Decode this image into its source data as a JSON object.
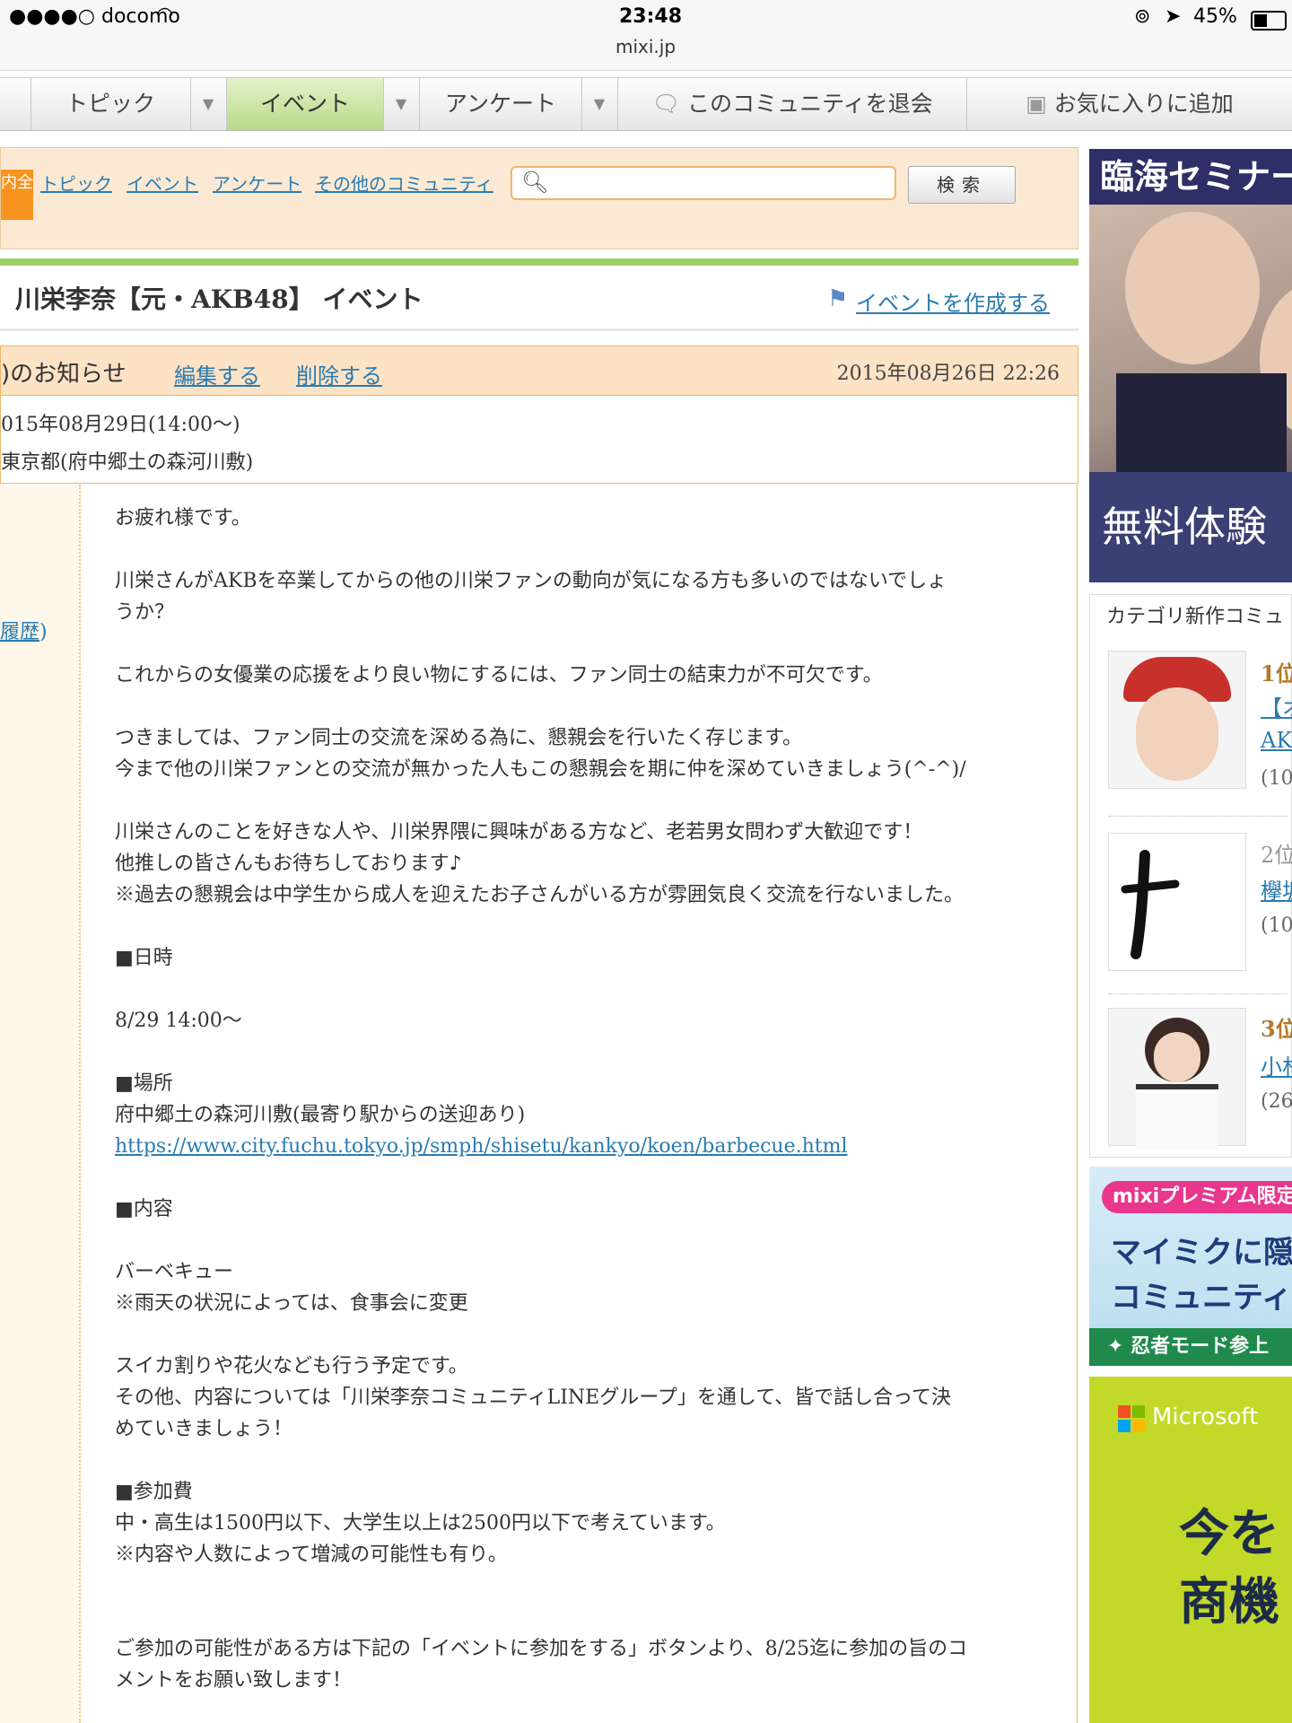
{
  "status_bar": {
    "carrier": "●●●●○ docomo",
    "time": "23:48",
    "url": "mixi.jp",
    "battery": "45%"
  },
  "tabs": [
    {
      "label": "トピック"
    },
    {
      "label": "イベント"
    },
    {
      "label": "アンケート"
    },
    {
      "label": "このコミュニティを退会"
    },
    {
      "label": "お気に入りに追加"
    }
  ],
  "search": {
    "badge": "内全",
    "links": [
      "トピック",
      "イベント",
      "アンケート",
      "その他のコミュニティ"
    ],
    "button": "検索",
    "placeholder": ""
  },
  "page": {
    "title": "川栄李奈【元・AKB48】 イベント",
    "create_link": "イベントを作成する"
  },
  "notice": {
    "label": ")のお知らせ",
    "edit": "編集する",
    "delete": "削除する",
    "date": "2015年08月26日 22:26",
    "event_date": "015年08月29日(14:00〜)",
    "event_place": "東京都(府中郷土の森河川敷)"
  },
  "history_link": "履歴",
  "body_lines": [
    "お疲れ様です。",
    "",
    "川栄さんがAKBを卒業してからの他の川栄ファンの動向が気になる方も多いのではないでしょ",
    "うか？",
    "",
    "これからの女優業の応援をより良い物にするには、ファン同士の結束力が不可欠です。",
    "",
    "つきましては、ファン同士の交流を深める為に、懇親会を行いたく存じます。",
    "今まで他の川栄ファンとの交流が無かった人もこの懇親会を期に仲を深めていきましょう(^-^)/",
    "",
    "川栄さんのことを好きな人や、川栄界隈に興味がある方など、老若男女問わず大歓迎です！",
    "他推しの皆さんもお待ちしております♪",
    "※過去の懇親会は中学生から成人を迎えたお子さんがいる方が雰囲気良く交流を行ないました。",
    "",
    "■日時",
    "",
    "8/29 14:00〜",
    "",
    "■場所",
    "府中郷土の森河川敷(最寄り駅からの送迎あり)",
    "https://www.city.fuchu.tokyo.jp/smph/shisetu/kankyo/koen/barbecue.html",
    "",
    "■内容",
    "",
    "バーベキュー",
    "※雨天の状況によっては、食事会に変更",
    "",
    "スイカ割りや花火なども行う予定です。",
    "その他、内容については「川栄李奈コミュニティLINEグループ」を通して、皆で話し合って決",
    "めていきましょう！",
    "",
    "■参加費",
    "中・高生は1500円以下、大学生以上は2500円以下で考えています。",
    "※内容や人数によって増減の可能性も有り。",
    "",
    "",
    "ご参加の可能性がある方は下記の「イベントに参加をする」ボタンより、8/25迄に参加の旨のコ",
    "メントをお願い致します！"
  ],
  "sidebar": {
    "ad1_top": "臨海セミナー",
    "ad1_bottom": "無料体験",
    "category_title": "カテゴリ新作コミュ",
    "ranks": [
      {
        "num": "1位",
        "line1": "【オ",
        "line2": "AK",
        "count": "(10"
      },
      {
        "num": "2位",
        "line1": "欅坂",
        "count": "(10"
      },
      {
        "num": "3位",
        "line1": "小林",
        "count": "(26"
      }
    ],
    "ad2_pill": "mixiプレミアム限定",
    "ad2_line1": "マイミクに隠",
    "ad2_line2": "コミュニティに参",
    "ad2_strip": "✦ 忍者モード参上",
    "ad3_brand": "Microsoft",
    "ad3_line1": "今を",
    "ad3_line2": "商機"
  }
}
